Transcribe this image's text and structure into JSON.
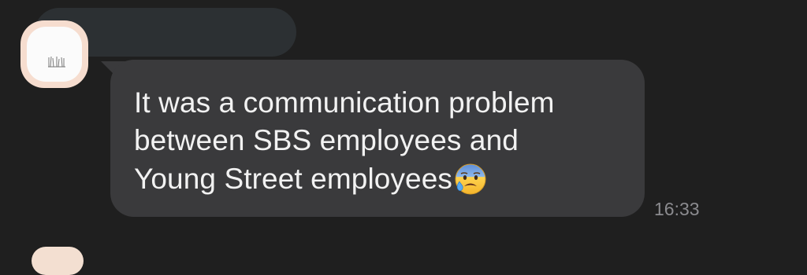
{
  "conversation": {
    "sender_name": "",
    "message": {
      "lines": [
        "It was a communication problem",
        "between SBS employees and",
        "Young Street employees"
      ],
      "emoji": "anxious-face-with-sweat",
      "time": "16:33"
    },
    "colors": {
      "background": "#1f1f1f",
      "bubble": "#3a3a3c",
      "message_text": "#f2f2f2",
      "timestamp": "#8b8b8f",
      "redaction": "#2c3033"
    }
  }
}
